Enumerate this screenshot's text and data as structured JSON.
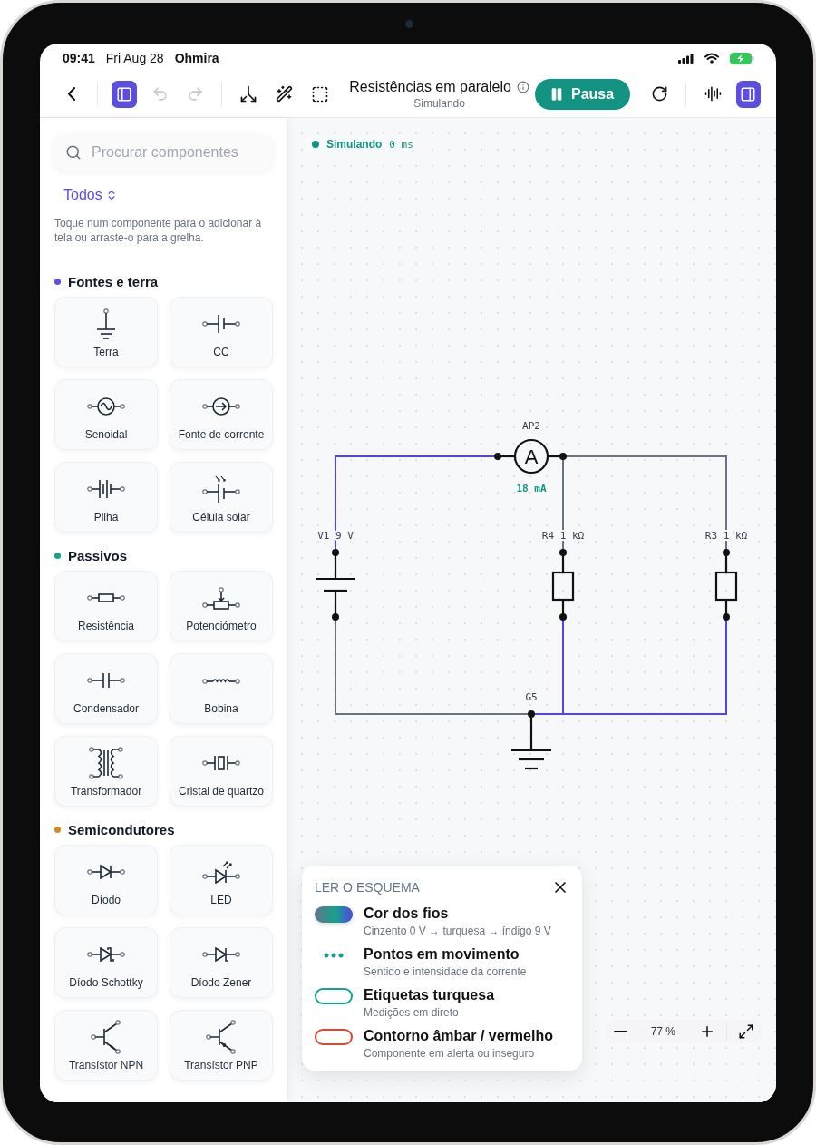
{
  "status_bar": {
    "time": "09:41",
    "date": "Fri Aug 28",
    "app": "Ohmira"
  },
  "toolbar": {
    "sidebar_toggle": {
      "on": true
    },
    "undo": {
      "disabled": true
    },
    "redo": {
      "disabled": true
    },
    "title": "Resistências em paralelo",
    "subtitle": "Simulando",
    "pause_button": "Pausa",
    "inspector_toggle": {
      "on": true
    }
  },
  "sidebar": {
    "search": {
      "placeholder": "Procurar componentes"
    },
    "filter": "Todos",
    "hint": "Toque num componente para o adicionar à tela ou arraste-o para a grelha.",
    "sections": [
      {
        "title": "Fontes e terra",
        "color": "#5b4ee0",
        "items": [
          {
            "kind": "ground",
            "label": "Terra"
          },
          {
            "kind": "dc",
            "label": "CC"
          },
          {
            "kind": "sine",
            "label": "Senoidal"
          },
          {
            "kind": "current",
            "label": "Fonte de corrente"
          },
          {
            "kind": "battery",
            "label": "Pilha"
          },
          {
            "kind": "solar",
            "label": "Célula solar"
          }
        ]
      },
      {
        "title": "Passivos",
        "color": "#14a38b",
        "items": [
          {
            "kind": "resistor",
            "label": "Resistência"
          },
          {
            "kind": "potentiometer",
            "label": "Potenciómetro"
          },
          {
            "kind": "capacitor",
            "label": "Condensador"
          },
          {
            "kind": "inductor",
            "label": "Bobina"
          },
          {
            "kind": "transformer",
            "label": "Transformador"
          },
          {
            "kind": "crystal",
            "label": "Cristal de quartzo"
          }
        ]
      },
      {
        "title": "Semicondutores",
        "color": "#d9891a",
        "items": [
          {
            "kind": "diode",
            "label": "Díodo"
          },
          {
            "kind": "led",
            "label": "LED"
          },
          {
            "kind": "schottky",
            "label": "Díodo Schottky"
          },
          {
            "kind": "zener",
            "label": "Díodo Zener"
          },
          {
            "kind": "npn",
            "label": "Transístor NPN"
          },
          {
            "kind": "pnp",
            "label": "Transístor PNP"
          }
        ]
      }
    ]
  },
  "canvas": {
    "status": {
      "label": "Simulando",
      "time": "0 ms"
    },
    "circuit": {
      "components": [
        {
          "kind": "ammeter",
          "name": "AP2",
          "symbol": "A",
          "reading": "18 mA"
        },
        {
          "kind": "source",
          "name": "V1",
          "value": "9 V"
        },
        {
          "kind": "resistor",
          "name": "R4",
          "value": "1 kΩ"
        },
        {
          "kind": "resistor",
          "name": "R3",
          "value": "1 kΩ"
        },
        {
          "kind": "ground",
          "name": "G5"
        }
      ],
      "wires": [
        {
          "color": "#4f46e5"
        },
        {
          "color": "#4f46e5"
        },
        {
          "color": "#6b7280"
        },
        {
          "color": "#6b7280"
        },
        {
          "color": "#6b7280"
        },
        {
          "color": "#6b7280"
        },
        {
          "color": "#6b7280"
        },
        {
          "color": "#4f46e5"
        },
        {
          "color": "#4f46e5"
        },
        {
          "color": "#4f46e5"
        }
      ]
    },
    "legend": {
      "title": "LER O ESQUEMA",
      "items": [
        {
          "kind": "gradient",
          "title": "Cor dos fios",
          "subtitle": "Cinzento 0 V → turquesa → índigo 9 V"
        },
        {
          "kind": "dots",
          "title": "Pontos em movimento",
          "subtitle": "Sentido e intensidade da corrente"
        },
        {
          "kind": "measure",
          "title": "Etiquetas turquesa",
          "subtitle": "Medições em direto"
        },
        {
          "kind": "alert",
          "title": "Contorno âmbar / vermelho",
          "subtitle": "Componente em alerta ou inseguro"
        }
      ]
    },
    "zoom": {
      "value": "77 %"
    }
  }
}
